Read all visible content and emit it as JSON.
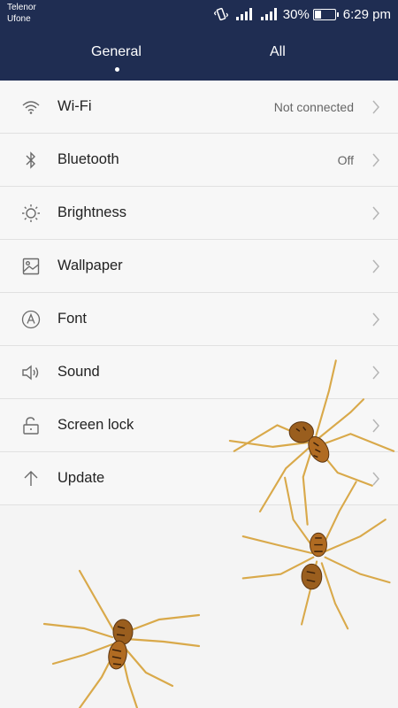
{
  "status_bar": {
    "carrier_1": "Telenor",
    "carrier_2": "Ufone",
    "battery_percent": "30%",
    "time": "6:29 pm"
  },
  "tabs": [
    {
      "label": "General",
      "selected": true
    },
    {
      "label": "All",
      "selected": false
    }
  ],
  "settings": [
    {
      "label": "Wi-Fi",
      "value": "Not connected",
      "icon": "wifi-icon"
    },
    {
      "label": "Bluetooth",
      "value": "Off",
      "icon": "bluetooth-icon"
    },
    {
      "label": "Brightness",
      "value": "",
      "icon": "brightness-icon"
    },
    {
      "label": "Wallpaper",
      "value": "",
      "icon": "wallpaper-icon"
    },
    {
      "label": "Font",
      "value": "",
      "icon": "font-icon"
    },
    {
      "label": "Sound",
      "value": "",
      "icon": "sound-icon"
    },
    {
      "label": "Screen lock",
      "value": "",
      "icon": "screen-lock-icon"
    },
    {
      "label": "Update",
      "value": "",
      "icon": "update-icon"
    }
  ],
  "colors": {
    "header_bg": "#1f2d52",
    "list_bg": "#f7f7f7",
    "icon": "#6b6b6b"
  }
}
